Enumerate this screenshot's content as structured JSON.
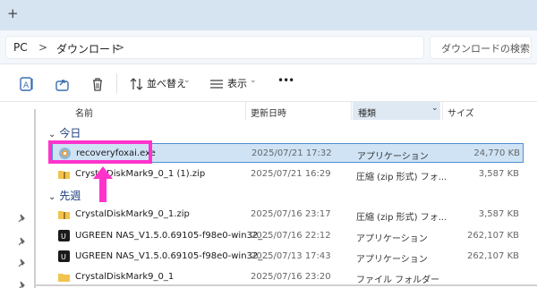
{
  "titlebar": {
    "new_tab_glyph": "+"
  },
  "address": {
    "crumbs": [
      "PC",
      "ダウンロード"
    ],
    "separator": ">",
    "search_placeholder": "ダウンロードの検索"
  },
  "toolbar": {
    "sort_label": "並べ替え",
    "view_label": "表示",
    "more_glyph": "•••",
    "icons": [
      "rename-icon",
      "share-icon",
      "delete-icon",
      "sort-icon",
      "view-icon"
    ]
  },
  "columns": {
    "name": "名前",
    "date": "更新日時",
    "type": "種類",
    "size": "サイズ",
    "sorted_column": "種類"
  },
  "groups": [
    {
      "label": "今日",
      "rows": [
        {
          "name": "recoveryfoxai.exe",
          "date": "2025/07/21 17:32",
          "type": "アプリケーション",
          "size": "24,770 KB",
          "icon": "app-icon"
        },
        {
          "name": "CrystalDiskMark9_0_1 (1).zip",
          "date": "2025/07/21 16:29",
          "type": "圧縮 (zip 形式) フォ...",
          "size": "3,587 KB",
          "icon": "zip-folder-icon"
        }
      ]
    },
    {
      "label": "先週",
      "rows": [
        {
          "name": "CrystalDiskMark9_0_1.zip",
          "date": "2025/07/16 23:17",
          "type": "圧縮 (zip 形式) フォ...",
          "size": "3,587 KB",
          "icon": "zip-folder-icon"
        },
        {
          "name": "UGREEN NAS_V1.5.0.69105-f98e0-win32_...",
          "date": "2025/07/16 22:12",
          "type": "アプリケーション",
          "size": "262,107 KB",
          "icon": "ugreen-app-icon"
        },
        {
          "name": "UGREEN NAS_V1.5.0.69105-f98e0-win32_...",
          "date": "2025/07/13 17:43",
          "type": "アプリケーション",
          "size": "262,107 KB",
          "icon": "ugreen-app-icon"
        },
        {
          "name": "CrystalDiskMark9_0_1",
          "date": "2025/07/16 23:20",
          "type": "ファイル フォルダー",
          "size": "",
          "icon": "folder-icon"
        }
      ]
    }
  ],
  "colors": {
    "highlight": "#ff33cc",
    "selection": "#cfe3f5",
    "titlebar": "#d6e3f0"
  }
}
